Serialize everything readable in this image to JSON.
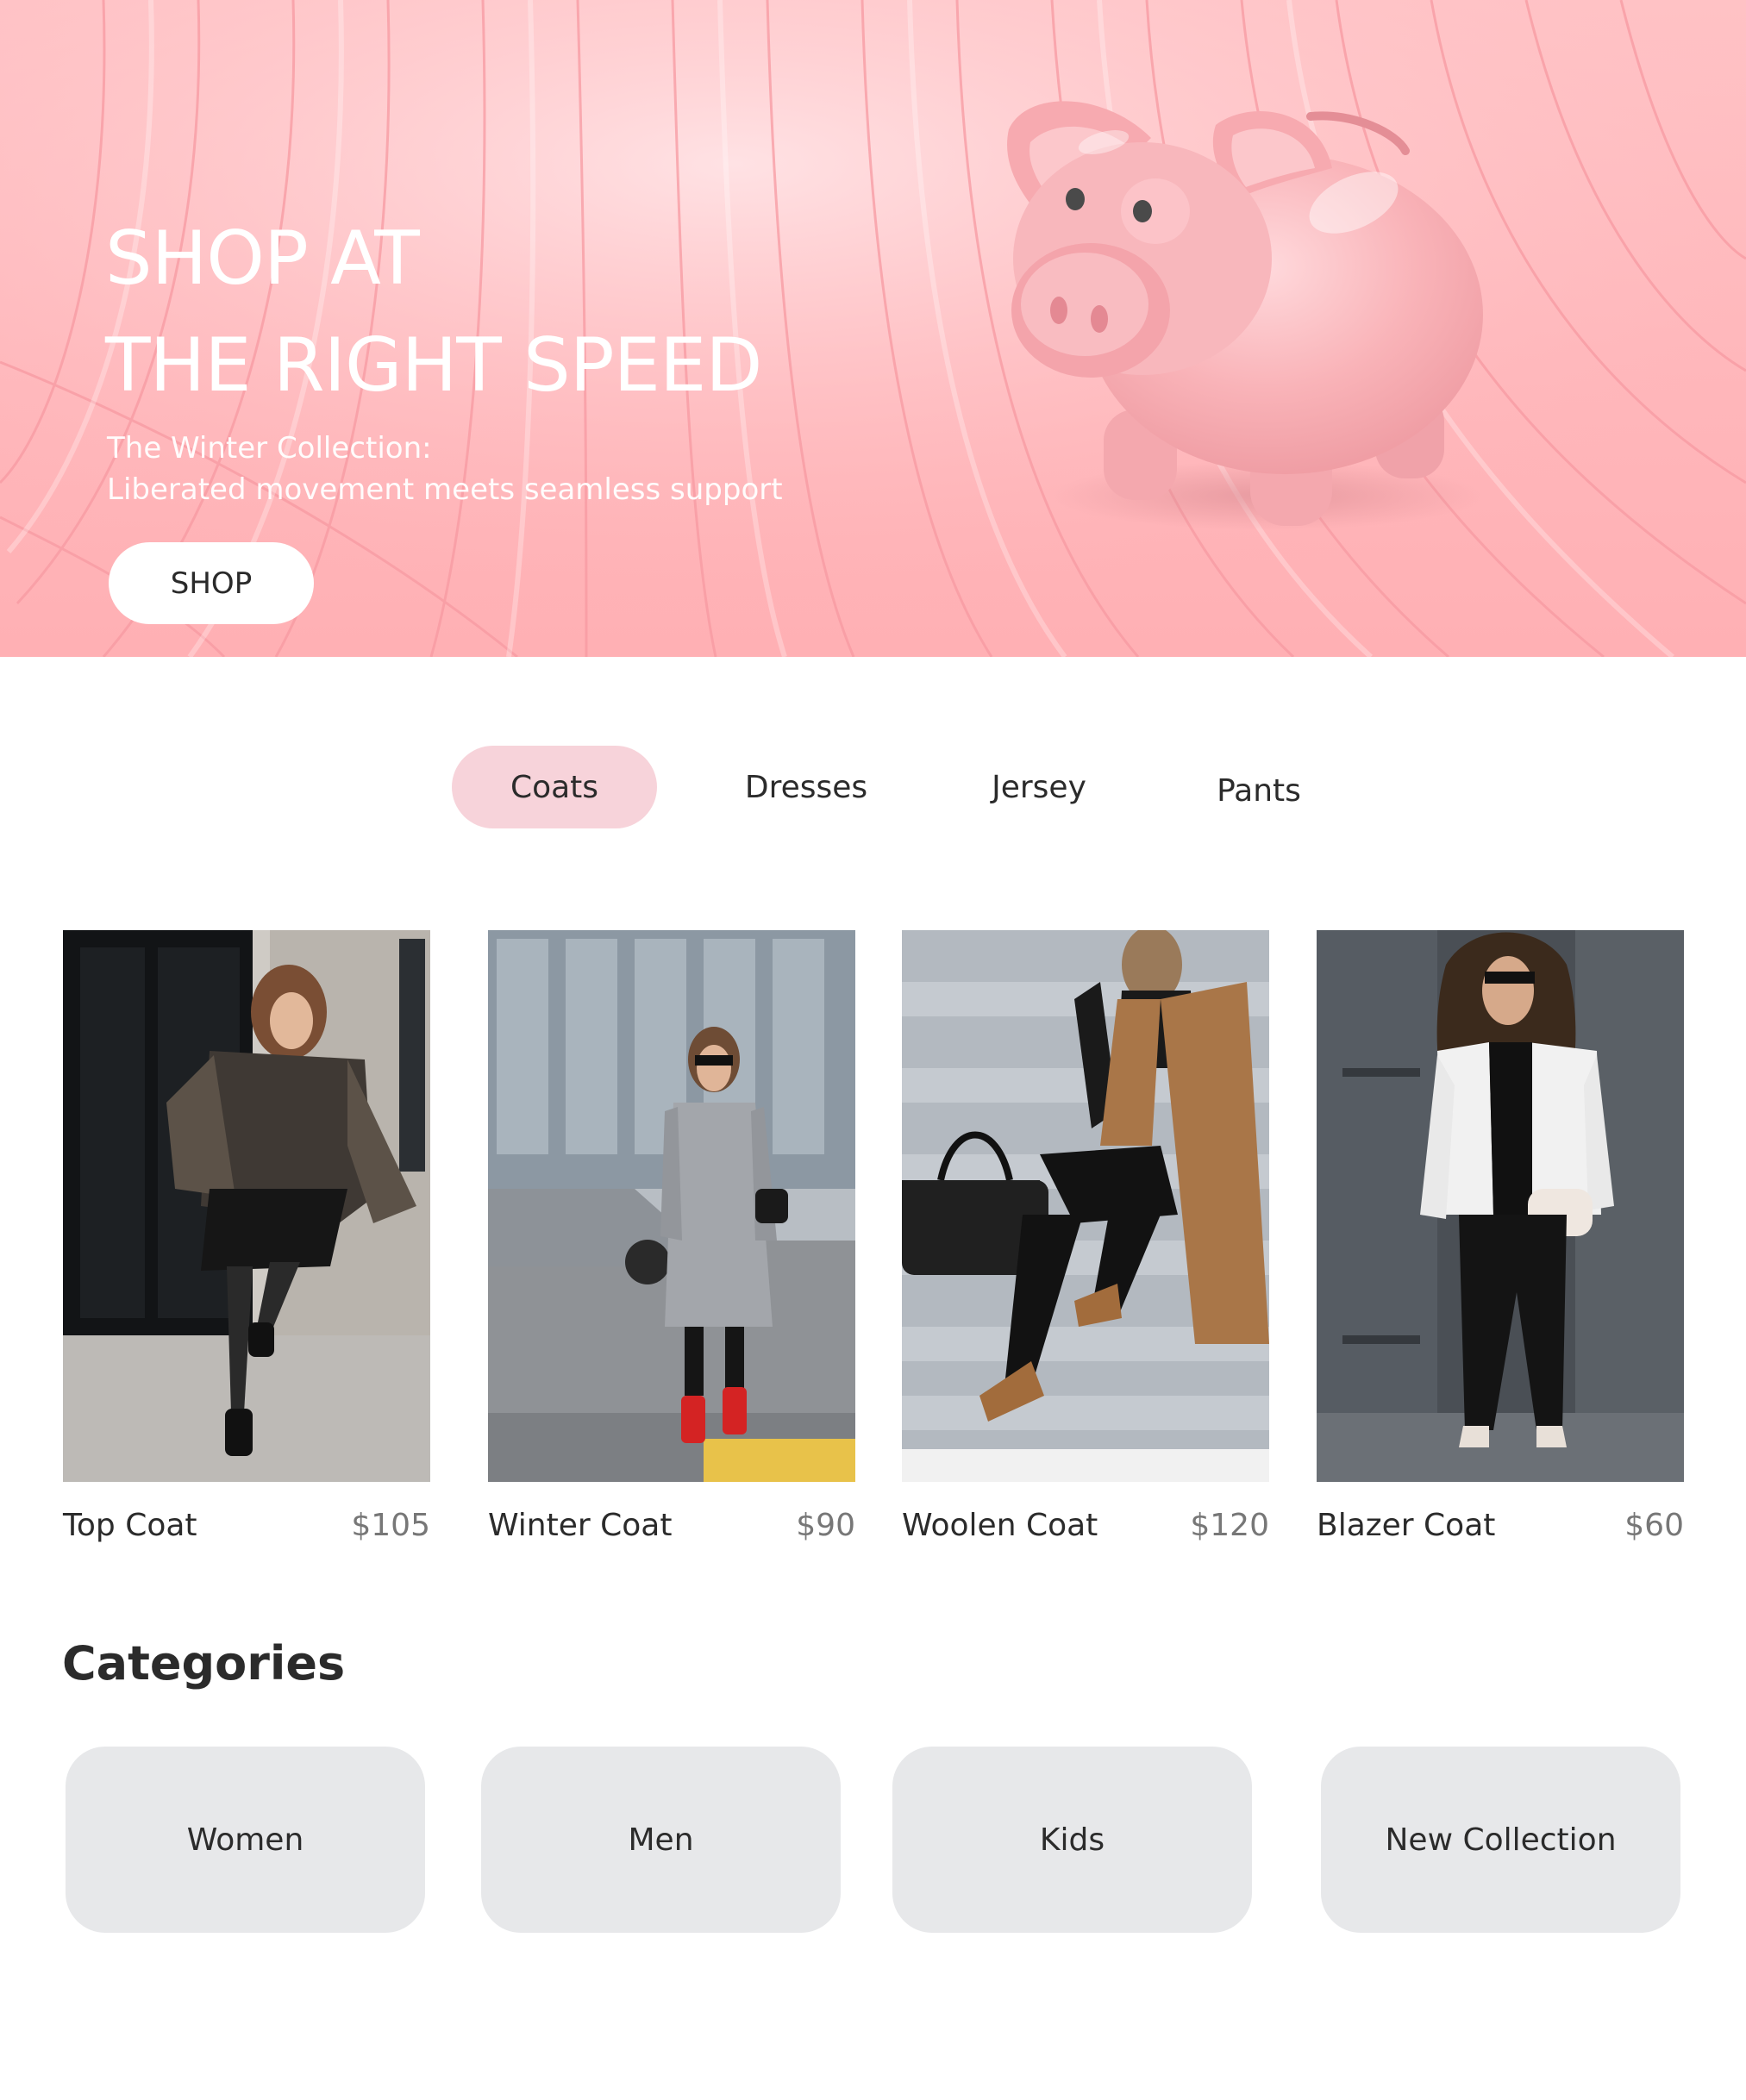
{
  "hero": {
    "title_line1": "SHOP AT",
    "title_line2": "THE RIGHT SPEED",
    "subtitle_line1": "The Winter Collection:",
    "subtitle_line2": "Liberated movement meets seamless support",
    "shop_label": "SHOP",
    "background_color": "#ffb7bb",
    "illustration": "piggy-bank-icon"
  },
  "tabs": [
    {
      "label": "Coats",
      "active": true
    },
    {
      "label": "Dresses",
      "active": false
    },
    {
      "label": "Jersey",
      "active": false
    },
    {
      "label": "Pants",
      "active": false
    }
  ],
  "products": [
    {
      "name": "Top Coat",
      "price": "$105"
    },
    {
      "name": "Winter Coat",
      "price": "$90"
    },
    {
      "name": "Woolen Coat",
      "price": "$120"
    },
    {
      "name": "Blazer Coat",
      "price": "$60"
    }
  ],
  "categories": {
    "heading": "Categories",
    "items": [
      {
        "label": "Women"
      },
      {
        "label": "Men"
      },
      {
        "label": "Kids"
      },
      {
        "label": "New Collection"
      }
    ]
  },
  "colors": {
    "active_tab": "#f7d3da",
    "category_card": "#e7e8ea",
    "price_text": "#777777"
  }
}
